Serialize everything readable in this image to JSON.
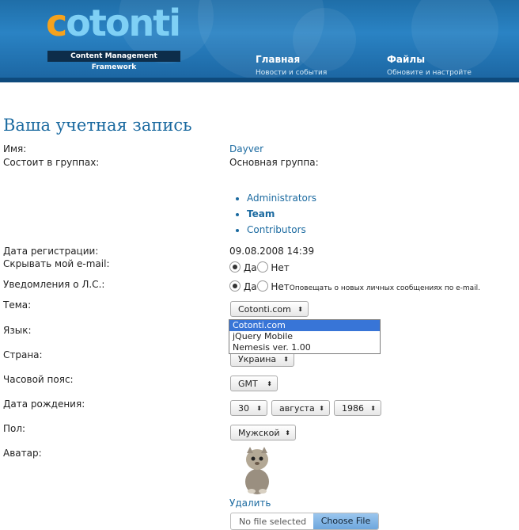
{
  "header": {
    "logo_first": "c",
    "logo_rest": "otonti",
    "tagline": "Content Management Framework",
    "nav": [
      {
        "title": "Главная",
        "subtitle": "Новости и события"
      },
      {
        "title": "Файлы",
        "subtitle": "Обновите и настройте"
      }
    ]
  },
  "page_title": "Ваша учетная запись",
  "fields": {
    "name_label": "Имя:",
    "name_value": "Dayver",
    "groups_label": "Состоит в группах:",
    "main_group_label": "Основная группа:",
    "groups": [
      {
        "label": "Administrators"
      },
      {
        "label": "Team"
      },
      {
        "label": "Contributors"
      }
    ],
    "reg_label": "Дата регистрации:",
    "reg_value": "09.08.2008 14:39",
    "hide_email_label": "Скрывать мой e-mail:",
    "yes": "Да",
    "no": "Нет",
    "pm_label": "Уведомления о Л.С.:",
    "pm_hint": "Оповещать о новых личных сообщениях по e-mail.",
    "theme_label": "Тема:",
    "theme_value": "Cotonti.com",
    "theme_options": [
      "Cotonti.com",
      "jQuery Mobile",
      "Nemesis ver. 1.00"
    ],
    "language_label": "Язык:",
    "country_label": "Страна:",
    "country_value": "Украина",
    "timezone_label": "Часовой пояс:",
    "timezone_value": "GMT",
    "birthdate_label": "Дата рождения:",
    "birth_day": "30",
    "birth_month": "августа",
    "birth_year": "1986",
    "gender_label": "Пол:",
    "gender_value": "Мужской",
    "avatar_label": "Аватар:",
    "delete_label": "Удалить",
    "no_file": "No file selected",
    "choose_file": "Choose File"
  }
}
